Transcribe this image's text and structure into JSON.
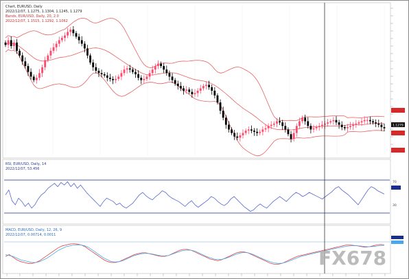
{
  "app": {
    "title": "Chart, EUR/USD, Daily"
  },
  "panels": {
    "price": {
      "header_line1": "Chart, EURUSD, Daily",
      "header_line2": "2022/12/07, 1.1275, 1.1304, 1.1245, 1.1279",
      "header_line3": "Bands, EUR/USD, Daily, 20, 2.0",
      "header_line4": "2022/12/07, 1.1515, 1.1292, 1.1062",
      "current_price_label": "1.1279"
    },
    "rsi": {
      "header_line1": "RSI, EUR/USD, Daily, 14",
      "header_line2": "2022/12/07, 53.456",
      "level_hi": "70",
      "level_lo": "30"
    },
    "macd": {
      "header_line1": "MACD, EUR/USD, Daily, 12, 26, 9",
      "header_line2": "2022/12/07, 0.00714, 0.0011"
    }
  },
  "watermark": {
    "text": "FX678"
  },
  "colors": {
    "candle_up": "#ff4a6e",
    "candle_down": "#000000",
    "bands": "#e86060",
    "rsi_line": "#5566cc",
    "rsi_level": "#1a2e8a",
    "macd_red": "#e04040",
    "macd_blue": "#4aa8e8",
    "macd_level": "#6aa9e8",
    "price_tag_red": "#d42a2a",
    "price_tag_black": "#111111",
    "cursor_line": "#333333",
    "watermark": "#b0b0b0"
  },
  "chart_data": [
    {
      "type": "line",
      "title": "",
      "xlabel": "",
      "ylabel": "",
      "ylim": [
        1.105,
        1.215
      ],
      "series": [
        {
          "name": "",
          "x": [
            0,
            1,
            2,
            3,
            4,
            5,
            6,
            7,
            8,
            9,
            10,
            11,
            12,
            13,
            14,
            15,
            16,
            17,
            18,
            19,
            20,
            21,
            22,
            23,
            24,
            25,
            26,
            27,
            28,
            29,
            30,
            31,
            32,
            33,
            34,
            35,
            36,
            37,
            38,
            39,
            40,
            41,
            42,
            43,
            44,
            45,
            46,
            47,
            48,
            49,
            50,
            51,
            52,
            53,
            54,
            55,
            56,
            57,
            58,
            59,
            60,
            61,
            62,
            63,
            64,
            65,
            66,
            67,
            68,
            69,
            70,
            71,
            72,
            73,
            74,
            75,
            76,
            77,
            78,
            79,
            80,
            81,
            82,
            83,
            84,
            85,
            86,
            87,
            88,
            89,
            90,
            91,
            92,
            93,
            94,
            95,
            96,
            97,
            98,
            99,
            100,
            101,
            102,
            103,
            104,
            105,
            106,
            107,
            108,
            109,
            110,
            111,
            112,
            113,
            114,
            115,
            116,
            117,
            118,
            119,
            120,
            121,
            122,
            123,
            124,
            125,
            126,
            127,
            128,
            129,
            130,
            131,
            132,
            133,
            134
          ],
          "values": [
            1.199,
            1.203,
            1.198,
            1.201,
            1.194,
            1.19,
            1.185,
            1.181,
            1.176,
            1.172,
            1.169,
            1.171,
            1.175,
            1.18,
            1.186,
            1.19,
            1.194,
            1.197,
            1.2,
            1.203,
            1.205,
            1.207,
            1.21,
            1.212,
            1.209,
            1.206,
            1.203,
            1.2,
            1.196,
            1.19,
            1.184,
            1.18,
            1.177,
            1.175,
            1.174,
            1.173,
            1.171,
            1.17,
            1.169,
            1.17,
            1.172,
            1.175,
            1.178,
            1.179,
            1.178,
            1.176,
            1.174,
            1.171,
            1.169,
            1.17,
            1.172,
            1.175,
            1.178,
            1.181,
            1.183,
            1.181,
            1.178,
            1.175,
            1.172,
            1.169,
            1.166,
            1.164,
            1.162,
            1.16,
            1.161,
            1.159,
            1.157,
            1.158,
            1.16,
            1.162,
            1.164,
            1.165,
            1.163,
            1.16,
            1.156,
            1.15,
            1.143,
            1.137,
            1.131,
            1.127,
            1.124,
            1.121,
            1.12,
            1.122,
            1.124,
            1.126,
            1.127,
            1.126,
            1.125,
            1.124,
            1.125,
            1.127,
            1.128,
            1.13,
            1.131,
            1.132,
            1.134,
            1.133,
            1.13,
            1.127,
            1.123,
            1.119,
            1.124,
            1.13,
            1.134,
            1.137,
            1.134,
            1.13,
            1.127,
            1.128,
            1.129,
            1.13,
            1.131,
            1.132,
            1.133,
            1.134,
            1.135,
            1.133,
            1.131,
            1.129,
            1.128,
            1.129,
            1.13,
            1.131,
            1.132,
            1.133,
            1.134,
            1.135,
            1.135,
            1.134,
            1.133,
            1.132,
            1.131,
            1.129,
            1.128
          ]
        }
      ]
    },
    {
      "type": "line",
      "title": "",
      "ylim": [
        20,
        80
      ],
      "series": [
        {
          "name": "",
          "values": [
            52,
            58,
            45,
            40,
            48,
            44,
            38,
            42,
            36,
            40,
            47,
            52,
            55,
            60,
            63,
            66,
            62,
            67,
            64,
            68,
            62,
            66,
            60,
            64,
            59,
            54,
            50,
            46,
            42,
            38,
            44,
            48,
            46,
            44,
            40,
            42,
            38,
            36,
            39,
            42,
            47,
            52,
            55,
            51,
            48,
            46,
            50,
            53,
            57,
            55,
            51,
            48,
            46,
            44,
            41,
            38,
            42,
            45,
            40,
            37,
            40,
            43,
            46,
            50,
            48,
            44,
            41,
            39,
            42,
            47,
            50,
            46,
            42,
            38,
            35,
            32,
            34,
            38,
            41,
            38,
            36,
            40,
            44,
            47,
            50,
            47,
            44,
            48,
            52,
            55,
            53,
            50,
            52,
            55,
            53,
            51,
            49,
            47,
            50,
            53,
            56,
            60,
            62,
            58,
            55,
            52,
            48,
            44,
            40,
            46,
            52,
            58,
            62,
            60,
            57,
            55,
            53
          ]
        }
      ]
    },
    {
      "type": "line",
      "title": "",
      "ylim": [
        -0.02,
        0.02
      ],
      "series": [
        {
          "name": "",
          "values": [
            -0.002,
            0.0,
            -0.003,
            -0.006,
            -0.008,
            -0.009,
            -0.01,
            -0.01,
            -0.009,
            -0.007,
            -0.004,
            -0.001,
            0.002,
            0.005,
            0.008,
            0.01,
            0.011,
            0.012,
            0.0125,
            0.012,
            0.011,
            0.009,
            0.006,
            0.003,
            0.0,
            -0.003,
            -0.006,
            -0.008,
            -0.009,
            -0.009,
            -0.008,
            -0.006,
            -0.004,
            -0.002,
            0.0,
            0.001,
            0.002,
            0.002,
            0.001,
            0.0,
            -0.001,
            -0.002,
            -0.002,
            -0.001,
            0.001,
            0.003,
            0.005,
            0.006,
            0.006,
            0.005,
            0.003,
            0.001,
            -0.001,
            -0.003,
            -0.005,
            -0.006,
            -0.007,
            -0.006,
            -0.004,
            -0.002,
            0.0,
            0.002,
            0.003,
            0.003,
            0.002,
            0.0,
            -0.002,
            -0.004,
            -0.006,
            -0.008,
            -0.01,
            -0.011,
            -0.011,
            -0.01,
            -0.008,
            -0.006,
            -0.004,
            -0.002,
            -0.001,
            0.0,
            0.001,
            0.002,
            0.003,
            0.004,
            0.005,
            0.006,
            0.007,
            0.008,
            0.009,
            0.01,
            0.011,
            0.011,
            0.0105,
            0.01,
            0.009,
            0.0085,
            0.009,
            0.01,
            0.011,
            0.0115,
            0.011
          ]
        },
        {
          "name": "",
          "values": [
            0.0,
            -0.001,
            -0.002,
            -0.004,
            -0.006,
            -0.007,
            -0.008,
            -0.009,
            -0.009,
            -0.008,
            -0.006,
            -0.004,
            -0.001,
            0.002,
            0.005,
            0.007,
            0.009,
            0.01,
            0.011,
            0.0112,
            0.011,
            0.01,
            0.008,
            0.005,
            0.002,
            -0.001,
            -0.004,
            -0.006,
            -0.008,
            -0.0085,
            -0.008,
            -0.007,
            -0.005,
            -0.003,
            -0.001,
            0.0,
            0.001,
            0.0015,
            0.0012,
            0.0005,
            -0.0005,
            -0.0012,
            -0.0015,
            -0.001,
            0.0005,
            0.002,
            0.0035,
            0.0048,
            0.0052,
            0.005,
            0.004,
            0.002,
            0.0,
            -0.002,
            -0.0035,
            -0.005,
            -0.0058,
            -0.0055,
            -0.0045,
            -0.003,
            -0.0012,
            0.0005,
            0.0018,
            0.0024,
            0.002,
            0.0008,
            -0.001,
            -0.003,
            -0.005,
            -0.0068,
            -0.0085,
            -0.0095,
            -0.01,
            -0.0098,
            -0.0088,
            -0.0072,
            -0.0055,
            -0.0038,
            -0.0022,
            -0.001,
            0.0,
            0.001,
            0.002,
            0.003,
            0.004,
            0.005,
            0.006,
            0.007,
            0.0078,
            0.0086,
            0.0094,
            0.01,
            0.0102,
            0.0101,
            0.0097,
            0.0092,
            0.009,
            0.0092,
            0.0097,
            0.0103,
            0.0107
          ]
        }
      ]
    }
  ]
}
